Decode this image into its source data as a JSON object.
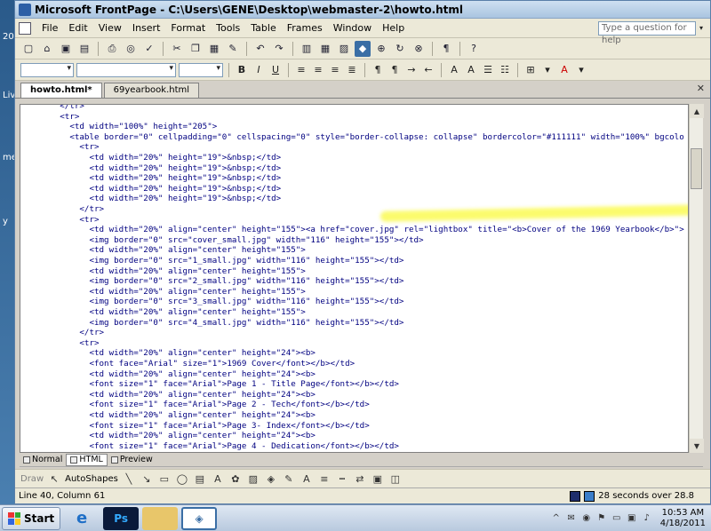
{
  "window": {
    "title": "Microsoft FrontPage - C:\\Users\\GENE\\Desktop\\webmaster-2\\howto.html"
  },
  "menu": {
    "items": [
      "File",
      "Edit",
      "View",
      "Insert",
      "Format",
      "Tools",
      "Table",
      "Frames",
      "Window",
      "Help"
    ],
    "help_placeholder": "Type a question for help"
  },
  "format_toolbar": {
    "bold": "B",
    "italic": "I",
    "underline": "U"
  },
  "tabs": [
    {
      "label": "howto.html*",
      "active": true
    },
    {
      "label": "69yearbook.html",
      "active": false
    }
  ],
  "code": {
    "lines": [
      "        </tr>",
      "        <tr>",
      "          <td width=\"100%\" height=\"205\">",
      "          <table border=\"0\" cellpadding=\"0\" cellspacing=\"0\" style=\"border-collapse: collapse\" bordercolor=\"#111111\" width=\"100%\" bgcolo",
      "            <tr>",
      "              <td width=\"20%\" height=\"19\">&nbsp;</td>",
      "              <td width=\"20%\" height=\"19\">&nbsp;</td>",
      "              <td width=\"20%\" height=\"19\">&nbsp;</td>",
      "              <td width=\"20%\" height=\"19\">&nbsp;</td>",
      "              <td width=\"20%\" height=\"19\">&nbsp;</td>",
      "            </tr>",
      "            <tr>",
      "              <td width=\"20%\" align=\"center\" height=\"155\"><a href=\"cover.jpg\" rel=\"lightbox\" title=\"<b>Cover of the 1969 Yearbook</b>\">",
      "              <img border=\"0\" src=\"cover_small.jpg\" width=\"116\" height=\"155\"></td>",
      "              <td width=\"20%\" align=\"center\" height=\"155\">",
      "              <img border=\"0\" src=\"1_small.jpg\" width=\"116\" height=\"155\"></td>",
      "              <td width=\"20%\" align=\"center\" height=\"155\">",
      "              <img border=\"0\" src=\"2_small.jpg\" width=\"116\" height=\"155\"></td>",
      "              <td width=\"20%\" align=\"center\" height=\"155\">",
      "              <img border=\"0\" src=\"3_small.jpg\" width=\"116\" height=\"155\"></td>",
      "              <td width=\"20%\" align=\"center\" height=\"155\">",
      "              <img border=\"0\" src=\"4_small.jpg\" width=\"116\" height=\"155\"></td>",
      "            </tr>",
      "            <tr>",
      "              <td width=\"20%\" align=\"center\" height=\"24\"><b>",
      "              <font face=\"Arial\" size=\"1\">1969 Cover</font></b></td>",
      "              <td width=\"20%\" align=\"center\" height=\"24\"><b>",
      "              <font size=\"1\" face=\"Arial\">Page 1 - Title Page</font></b></td>",
      "              <td width=\"20%\" align=\"center\" height=\"24\"><b>",
      "              <font size=\"1\" face=\"Arial\">Page 2 - Tech</font></b></td>",
      "              <td width=\"20%\" align=\"center\" height=\"24\"><b>",
      "              <font size=\"1\" face=\"Arial\">Page 3- Index</font></b></td>",
      "              <td width=\"20%\" align=\"center\" height=\"24\"><b>",
      "              <font size=\"1\" face=\"Arial\">Page 4 - Dedication</font></b></td>"
    ]
  },
  "view_tabs": [
    {
      "label": "Normal",
      "active": false
    },
    {
      "label": "HTML",
      "active": true
    },
    {
      "label": "Preview",
      "active": false
    }
  ],
  "drawing": {
    "draw_label": "Draw",
    "autoshapes_label": "AutoShapes"
  },
  "status": {
    "position": "Line 40, Column 61",
    "speed": "28 seconds over 28.8"
  },
  "taskbar": {
    "start_label": "Start",
    "time": "10:53 AM",
    "date": "4/18/2011",
    "ps_label": "Ps"
  },
  "desktop_labels": [
    "20",
    "Liv",
    "me",
    "y"
  ]
}
